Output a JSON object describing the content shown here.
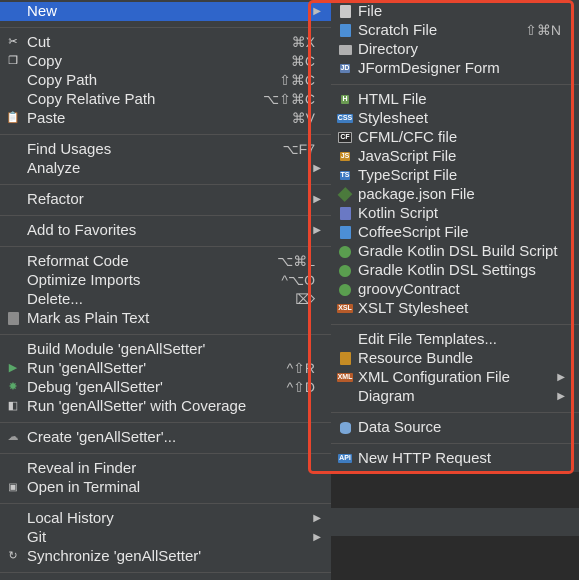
{
  "left_menu": {
    "items": [
      {
        "label": "New",
        "shortcut": "",
        "submenu": true,
        "selected": true,
        "icon": ""
      },
      {
        "label": "Cut",
        "shortcut": "⌘X",
        "icon": "scissors-icon"
      },
      {
        "label": "Copy",
        "shortcut": "⌘C",
        "icon": "copy-icon"
      },
      {
        "label": "Copy Path",
        "shortcut": "⇧⌘C",
        "icon": ""
      },
      {
        "label": "Copy Relative Path",
        "shortcut": "⌥⇧⌘C",
        "icon": ""
      },
      {
        "label": "Paste",
        "shortcut": "⌘V",
        "icon": "paste-icon"
      },
      {
        "label": "Find Usages",
        "shortcut": "⌥F7",
        "icon": ""
      },
      {
        "label": "Analyze",
        "shortcut": "",
        "submenu": true,
        "icon": ""
      },
      {
        "label": "Refactor",
        "shortcut": "",
        "submenu": true,
        "icon": ""
      },
      {
        "label": "Add to Favorites",
        "shortcut": "",
        "submenu": true,
        "icon": ""
      },
      {
        "label": "Reformat Code",
        "shortcut": "⌥⌘L",
        "icon": ""
      },
      {
        "label": "Optimize Imports",
        "shortcut": "^⌥O",
        "icon": ""
      },
      {
        "label": "Delete...",
        "shortcut": "⌦",
        "icon": ""
      },
      {
        "label": "Mark as Plain Text",
        "shortcut": "",
        "icon": "plain-text-icon"
      },
      {
        "label": "Build Module 'genAllSetter'",
        "shortcut": "",
        "icon": ""
      },
      {
        "label": "Run 'genAllSetter'",
        "shortcut": "^⇧R",
        "icon": "run-icon"
      },
      {
        "label": "Debug 'genAllSetter'",
        "shortcut": "^⇧D",
        "icon": "debug-icon"
      },
      {
        "label": "Run 'genAllSetter' with Coverage",
        "shortcut": "",
        "icon": "coverage-icon"
      },
      {
        "label": "Create 'genAllSetter'...",
        "shortcut": "",
        "icon": "create-config-icon"
      },
      {
        "label": "Reveal in Finder",
        "shortcut": "",
        "icon": ""
      },
      {
        "label": "Open in Terminal",
        "shortcut": "",
        "icon": "terminal-icon"
      },
      {
        "label": "Local History",
        "shortcut": "",
        "submenu": true,
        "icon": ""
      },
      {
        "label": "Git",
        "shortcut": "",
        "submenu": true,
        "icon": ""
      },
      {
        "label": "Synchronize 'genAllSetter'",
        "shortcut": "",
        "icon": "sync-icon"
      }
    ]
  },
  "new_submenu": {
    "items": [
      {
        "label": "File",
        "shortcut": "",
        "icon": "file-icon"
      },
      {
        "label": "Scratch File",
        "shortcut": "⇧⌘N",
        "icon": "scratch-file-icon"
      },
      {
        "label": "Directory",
        "shortcut": "",
        "icon": "folder-icon"
      },
      {
        "label": "JFormDesigner Form",
        "shortcut": "",
        "icon": "jformdesigner-icon"
      },
      {
        "label": "HTML File",
        "shortcut": "",
        "icon": "html-file-icon"
      },
      {
        "label": "Stylesheet",
        "shortcut": "",
        "icon": "css-file-icon"
      },
      {
        "label": "CFML/CFC file",
        "shortcut": "",
        "icon": "cfml-file-icon"
      },
      {
        "label": "JavaScript File",
        "shortcut": "",
        "icon": "javascript-file-icon"
      },
      {
        "label": "TypeScript File",
        "shortcut": "",
        "icon": "typescript-file-icon"
      },
      {
        "label": "package.json File",
        "shortcut": "",
        "icon": "package-json-icon"
      },
      {
        "label": "Kotlin Script",
        "shortcut": "",
        "icon": "kotlin-script-icon"
      },
      {
        "label": "CoffeeScript File",
        "shortcut": "",
        "icon": "coffeescript-file-icon"
      },
      {
        "label": "Gradle Kotlin DSL Build Script",
        "shortcut": "",
        "icon": "gradle-icon"
      },
      {
        "label": "Gradle Kotlin DSL Settings",
        "shortcut": "",
        "icon": "gradle-icon"
      },
      {
        "label": "groovyContract",
        "shortcut": "",
        "icon": "groovy-icon"
      },
      {
        "label": "XSLT Stylesheet",
        "shortcut": "",
        "icon": "xslt-file-icon"
      },
      {
        "label": "Edit File Templates...",
        "shortcut": "",
        "icon": ""
      },
      {
        "label": "Resource Bundle",
        "shortcut": "",
        "icon": "resource-bundle-icon"
      },
      {
        "label": "XML Configuration File",
        "shortcut": "",
        "submenu": true,
        "icon": "xml-file-icon"
      },
      {
        "label": "Diagram",
        "shortcut": "",
        "submenu": true,
        "icon": ""
      },
      {
        "label": "Data Source",
        "shortcut": "",
        "icon": "database-icon"
      },
      {
        "label": "New HTTP Request",
        "shortcut": "",
        "icon": "http-request-icon"
      }
    ]
  },
  "colors": {
    "menu_bg": "#3c3f41",
    "selection": "#2f65ca",
    "highlight_border": "#e8452d",
    "separator": "#515151"
  }
}
